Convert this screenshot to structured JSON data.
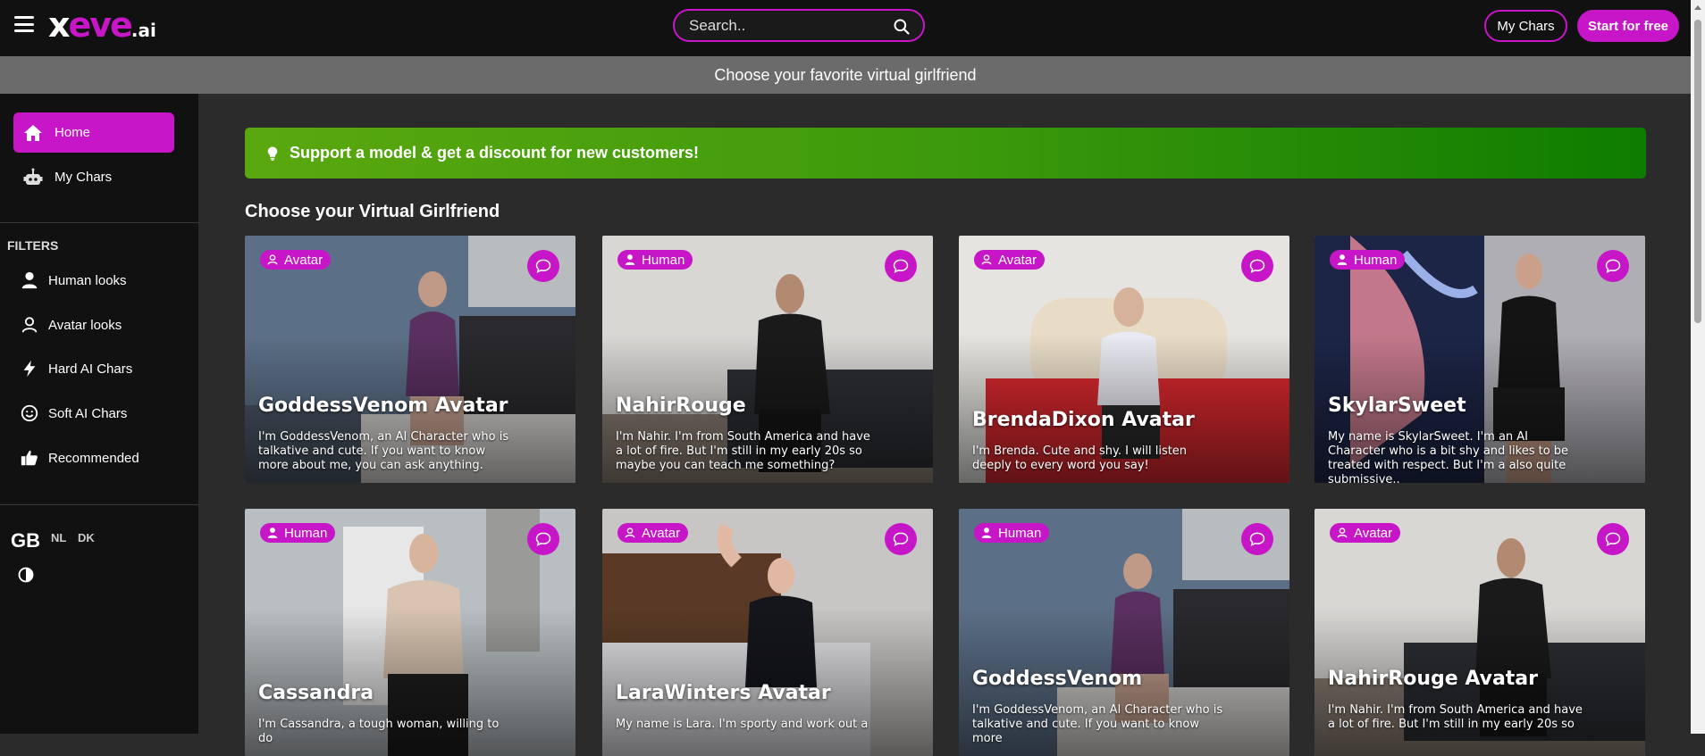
{
  "header": {
    "logo": {
      "x": "x",
      "eve": "eve",
      "ai": ".ai"
    },
    "search_placeholder": "Search..",
    "my_chars_label": "My Chars",
    "start_label": "Start for free"
  },
  "banner_text": "Choose your favorite virtual girlfriend",
  "sidebar": {
    "nav": [
      {
        "label": "Home",
        "icon": "home-icon"
      },
      {
        "label": "My Chars",
        "icon": "robot-icon"
      }
    ],
    "filters_title": "FILTERS",
    "filters": [
      {
        "label": "Human looks",
        "icon": "person-icon"
      },
      {
        "label": "Avatar looks",
        "icon": "avatar-icon"
      },
      {
        "label": "Hard AI Chars",
        "icon": "bolt-icon"
      },
      {
        "label": "Soft AI Chars",
        "icon": "smile-icon"
      },
      {
        "label": "Recommended",
        "icon": "thumbs-up-icon"
      }
    ],
    "languages": [
      "GB",
      "NL",
      "DK"
    ]
  },
  "promo_text": "Support a model & get a discount for new customers!",
  "section_title": "Choose your Virtual Girlfriend",
  "cards": [
    {
      "type": "Avatar",
      "name": "GoddessVenom Avatar",
      "desc": "I'm GoddessVenom, an AI Character who is talkative and cute. If you want to know more about me, you can ask anything."
    },
    {
      "type": "Human",
      "name": "NahirRouge",
      "desc": "I'm Nahir. I'm from South America and have a lot of fire. But I'm still in my early 20s so maybe you can teach me something?"
    },
    {
      "type": "Avatar",
      "name": "BrendaDixon Avatar",
      "desc": "I'm Brenda. Cute and shy. I will listen deeply to every word you say!"
    },
    {
      "type": "Human",
      "name": "SkylarSweet",
      "desc": "My name is SkylarSweet. I'm an AI Character who is a bit shy and likes to be treated with respect. But I'm a also quite submissive.."
    },
    {
      "type": "Human",
      "name": "Cassandra",
      "desc": "I'm Cassandra, a tough woman, willing to do"
    },
    {
      "type": "Avatar",
      "name": "LaraWinters Avatar",
      "desc": "My name is Lara. I'm sporty and work out a"
    },
    {
      "type": "Human",
      "name": "GoddessVenom",
      "desc": "I'm GoddessVenom, an AI Character who is talkative and cute. If you want to know more"
    },
    {
      "type": "Avatar",
      "name": "NahirRouge Avatar",
      "desc": "I'm Nahir. I'm from South America and have a lot of fire. But I'm still in my early 20s so"
    }
  ],
  "colors": {
    "accent": "#c716c7",
    "topbar": "#111111",
    "content_bg": "#2b2b2b",
    "promo_start": "#5aa80f",
    "promo_end": "#0e7c00"
  }
}
